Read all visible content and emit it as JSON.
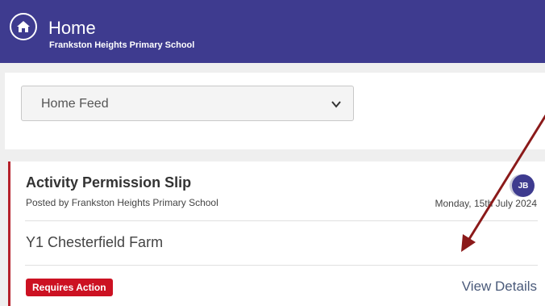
{
  "header": {
    "title": "Home",
    "school": "Frankston Heights Primary School",
    "background_color": "#3e3b8f",
    "home_icon": "home-icon"
  },
  "feed_selector": {
    "value": "Home Feed",
    "icon": "chevron-down-icon"
  },
  "post": {
    "title": "Activity Permission Slip",
    "posted_by": "Posted by Frankston Heights Primary School",
    "avatar_initials": "JB",
    "date": "Monday, 15th July 2024",
    "body": "Y1 Chesterfield Farm",
    "badge": "Requires Action",
    "badge_color": "#cc1122",
    "view_details": "View Details",
    "accent_color": "#b5212b"
  },
  "annotation": {
    "icon": "arrow-annotation",
    "color": "#8b1a1a"
  }
}
